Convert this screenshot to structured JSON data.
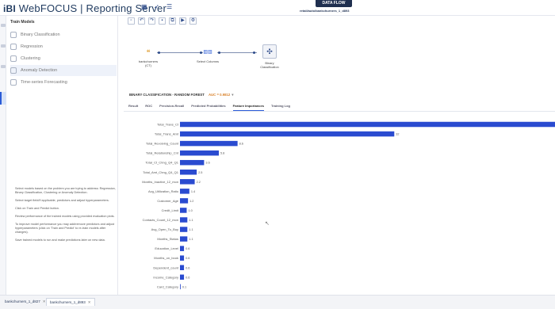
{
  "app": {
    "title": "WebFOCUS | Reporting Server",
    "logo": "iBI"
  },
  "data_flow": {
    "tab_label": "DATA FLOW",
    "subtitle": "retail/auto/bankchurners_1_d893"
  },
  "top_icons": [
    "grid-icon",
    "rocket-icon",
    "list-icon"
  ],
  "sidebar": {
    "title": "Train Models",
    "items": [
      {
        "label": "Binary Classification",
        "icon": "binary-icon"
      },
      {
        "label": "Regression",
        "icon": "regression-icon"
      },
      {
        "label": "Clustering",
        "icon": "clustering-icon"
      },
      {
        "label": "Anomaly Detection",
        "icon": "anomaly-icon"
      },
      {
        "label": "Time-series Forecasting",
        "icon": "timeseries-icon"
      }
    ],
    "description": [
      "Select models based on the problem you are trying to address: Regression, Binary Classification, Clustering or Anomaly Detection.",
      "Select target field/If applicable, predictors and adjust hyperparameters.",
      "Click on Train and Predict button.",
      "Review performance of the trained models using provided evaluation plots.",
      "To improve model performance you may add/remove predictors and adjust hyperparameters (click on 'Train and Predict' to re-train models after changes).",
      "Save trained models to run and make predictions later on new data."
    ]
  },
  "toolbar": [
    "save-icon",
    "undo-icon",
    "redo-icon",
    "run-icon",
    "copy-icon",
    "play-icon",
    "settings-icon"
  ],
  "flow": {
    "nodes": [
      {
        "label": "bankchurners",
        "sublabel": "(CT)"
      },
      {
        "label": "Select Columns",
        "sublabel": ""
      },
      {
        "label": "Binary",
        "sublabel": "Classification"
      }
    ]
  },
  "panel": {
    "title": "BINARY CLASSIFICATION - RANDOM FOREST",
    "auc": "AUC = 0.9812",
    "tabs": [
      "Result",
      "ROC",
      "Precision-Recall",
      "Predicted Probabilities",
      "Feature Importances",
      "Training Log"
    ],
    "active_tab": "Feature Importances"
  },
  "chart_data": {
    "type": "bar",
    "orientation": "horizontal",
    "categories": [
      "Total_Trans_Ct",
      "Total_Trans_Amt",
      "Total_Revolving_Count",
      "Total_Relationship_Cnt",
      "Total_Ct_Chng_Q4_Q1",
      "Total_Amt_Chng_Q4_Q1",
      "Months_Inactive_12_mon",
      "Avg_Utilization_Ratio",
      "Customer_Age",
      "Credit_Limit",
      "Contacts_Count_12_mon",
      "Avg_Open_To_Buy",
      "Months_Status",
      "Education_Level",
      "Months_on_book",
      "Dependent_count",
      "Income_Category",
      "Card_Category"
    ],
    "values": [
      null,
      32,
      8.6,
      5.8,
      3.6,
      2.5,
      2.2,
      1.4,
      1.2,
      1.0,
      1.1,
      1.1,
      1.1,
      0.6,
      0.6,
      0.6,
      0.6,
      0.1
    ],
    "value_labels": [
      "",
      "32",
      "8.6",
      "5.8",
      "3.6",
      "2.5",
      "2.2",
      "1.4",
      "1.2",
      "1.0",
      "1.1",
      "1.1",
      "1.1",
      "0.6",
      "0.6",
      "0.6",
      "0.6",
      "0.1"
    ],
    "bar_color": "#2a4bd0",
    "xlim": [
      0,
      56
    ]
  },
  "bottom_tabs": [
    {
      "label": "bankchurners_1_d827",
      "active": false
    },
    {
      "label": "bankchurners_1_d893",
      "active": true
    }
  ]
}
